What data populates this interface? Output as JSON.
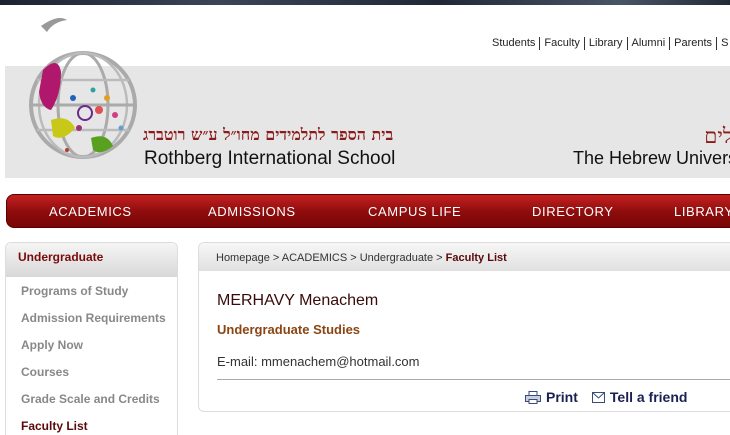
{
  "top_links": [
    "Students",
    "Faculty",
    "Library",
    "Alumni",
    "Parents",
    "S"
  ],
  "header": {
    "school_hebrew": "בית הספר לתלמידים מחו״ל ע״ש רוטברג",
    "school_english": "Rothberg International School",
    "university_hebrew": "האוניברסיטה העברית בירושלים",
    "university_english": "The Hebrew University of Jerusalem"
  },
  "nav": [
    "ACADEMICS",
    "ADMISSIONS",
    "CAMPUS LIFE",
    "DIRECTORY",
    "LIBRARY"
  ],
  "sidebar": {
    "title": "Undergraduate",
    "items": [
      "Programs of Study",
      "Admission Requirements",
      "Apply Now",
      "Courses",
      "Grade Scale and Credits",
      "Faculty List"
    ]
  },
  "breadcrumb": {
    "parts": [
      "Homepage",
      "ACADEMICS",
      "Undergraduate"
    ],
    "current": "Faculty List",
    "sep": " > "
  },
  "profile": {
    "name": "MERHAVY Menachem",
    "department": "Undergraduate Studies",
    "email_label": "E-mail:",
    "email": "mmenachem@hotmail.com"
  },
  "actions": {
    "print": "Print",
    "tell": "Tell a friend"
  }
}
